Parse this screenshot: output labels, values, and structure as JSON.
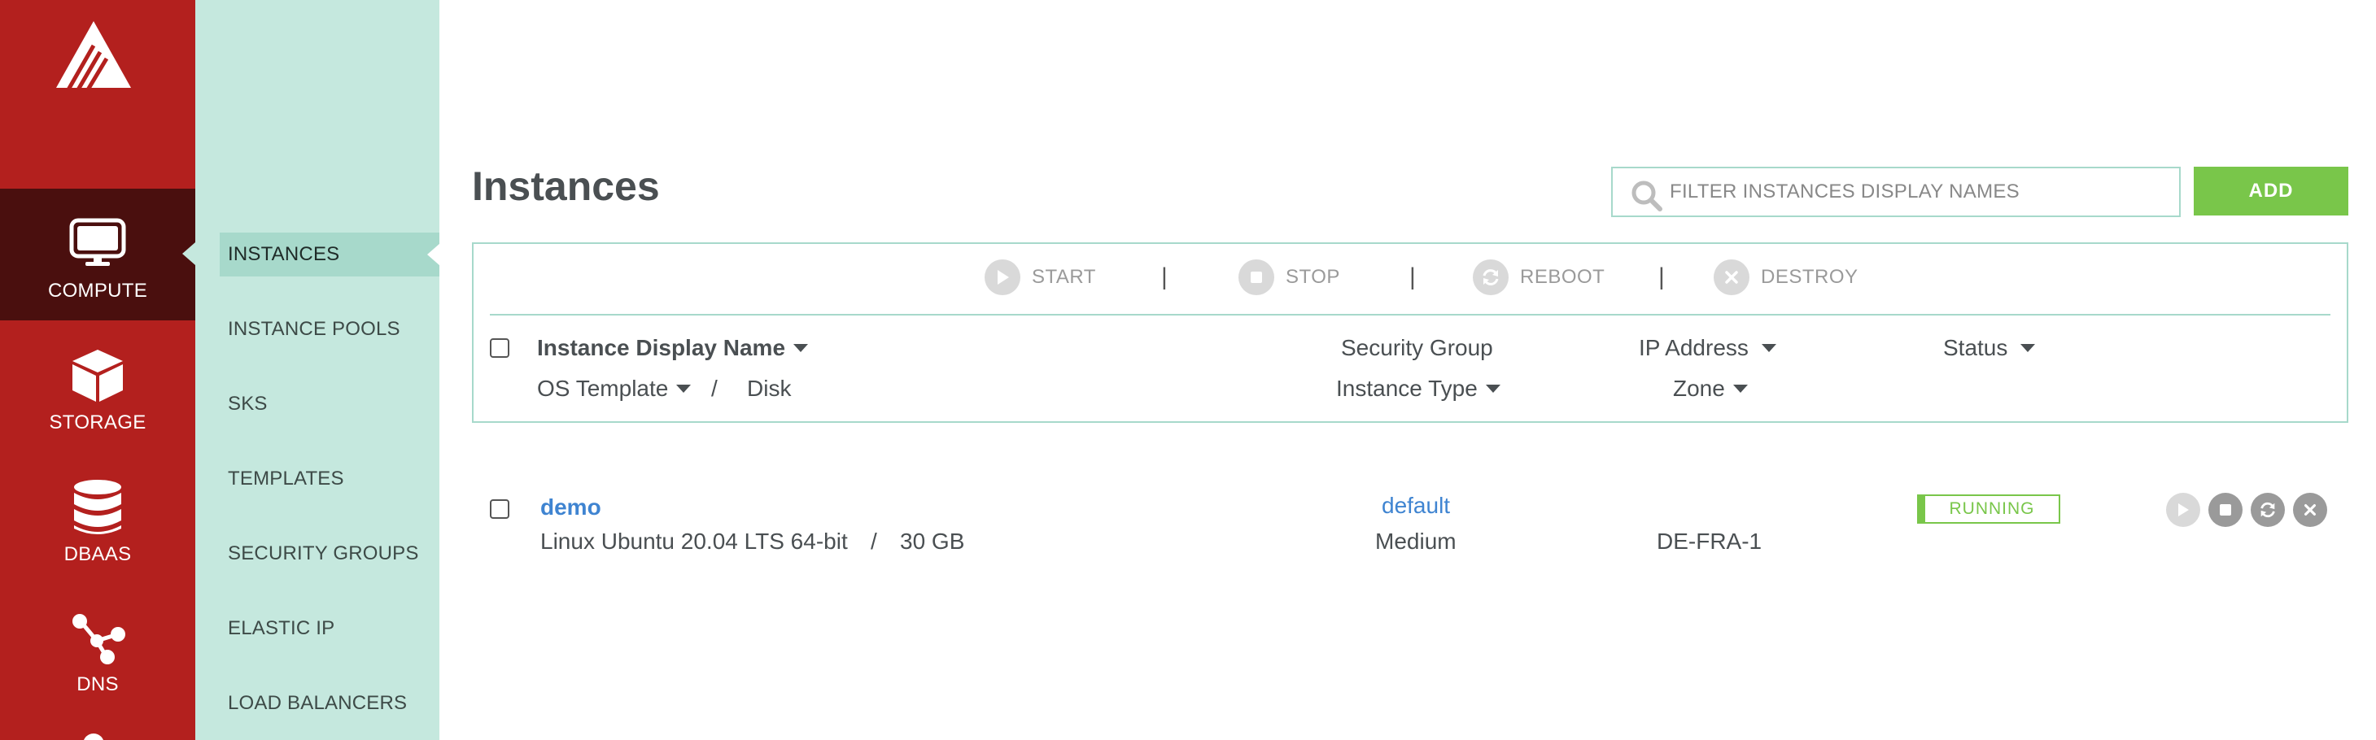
{
  "primary_nav": {
    "items": [
      {
        "label": "COMPUTE",
        "icon": "monitor-icon",
        "active": true
      },
      {
        "label": "STORAGE",
        "icon": "cube-icon"
      },
      {
        "label": "DBAAS",
        "icon": "database-icon"
      },
      {
        "label": "DNS",
        "icon": "share-nodes-icon"
      }
    ]
  },
  "secondary_nav": {
    "items": [
      {
        "label": "INSTANCES",
        "active": true
      },
      {
        "label": "INSTANCE POOLS"
      },
      {
        "label": "SKS"
      },
      {
        "label": "TEMPLATES"
      },
      {
        "label": "SECURITY GROUPS"
      },
      {
        "label": "ELASTIC IP"
      },
      {
        "label": "LOAD BALANCERS"
      }
    ]
  },
  "page": {
    "title": "Instances",
    "filter_placeholder": "FILTER INSTANCES DISPLAY NAMES",
    "add_label": "ADD"
  },
  "toolbar": {
    "start": "START",
    "stop": "STOP",
    "reboot": "REBOOT",
    "destroy": "DESTROY",
    "separator": "|"
  },
  "columns": {
    "display_name": "Instance Display Name",
    "os_template": "OS Template",
    "slash": "/",
    "disk": "Disk",
    "security_group": "Security Group",
    "instance_type": "Instance Type",
    "ip_address": "IP Address",
    "zone": "Zone",
    "status": "Status"
  },
  "instances": [
    {
      "name": "demo",
      "os": "Linux Ubuntu 20.04 LTS 64-bit",
      "slash": "/",
      "disk": "30 GB",
      "security_group": "default",
      "instance_type": "Medium",
      "zone": "DE-FRA-1",
      "status": "RUNNING"
    }
  ],
  "colors": {
    "primary_red": "#b3201e",
    "active_dark": "#4a0f0e",
    "mint": "#c5e8de",
    "accent_green": "#79c64a",
    "link_blue": "#3f84d1"
  }
}
